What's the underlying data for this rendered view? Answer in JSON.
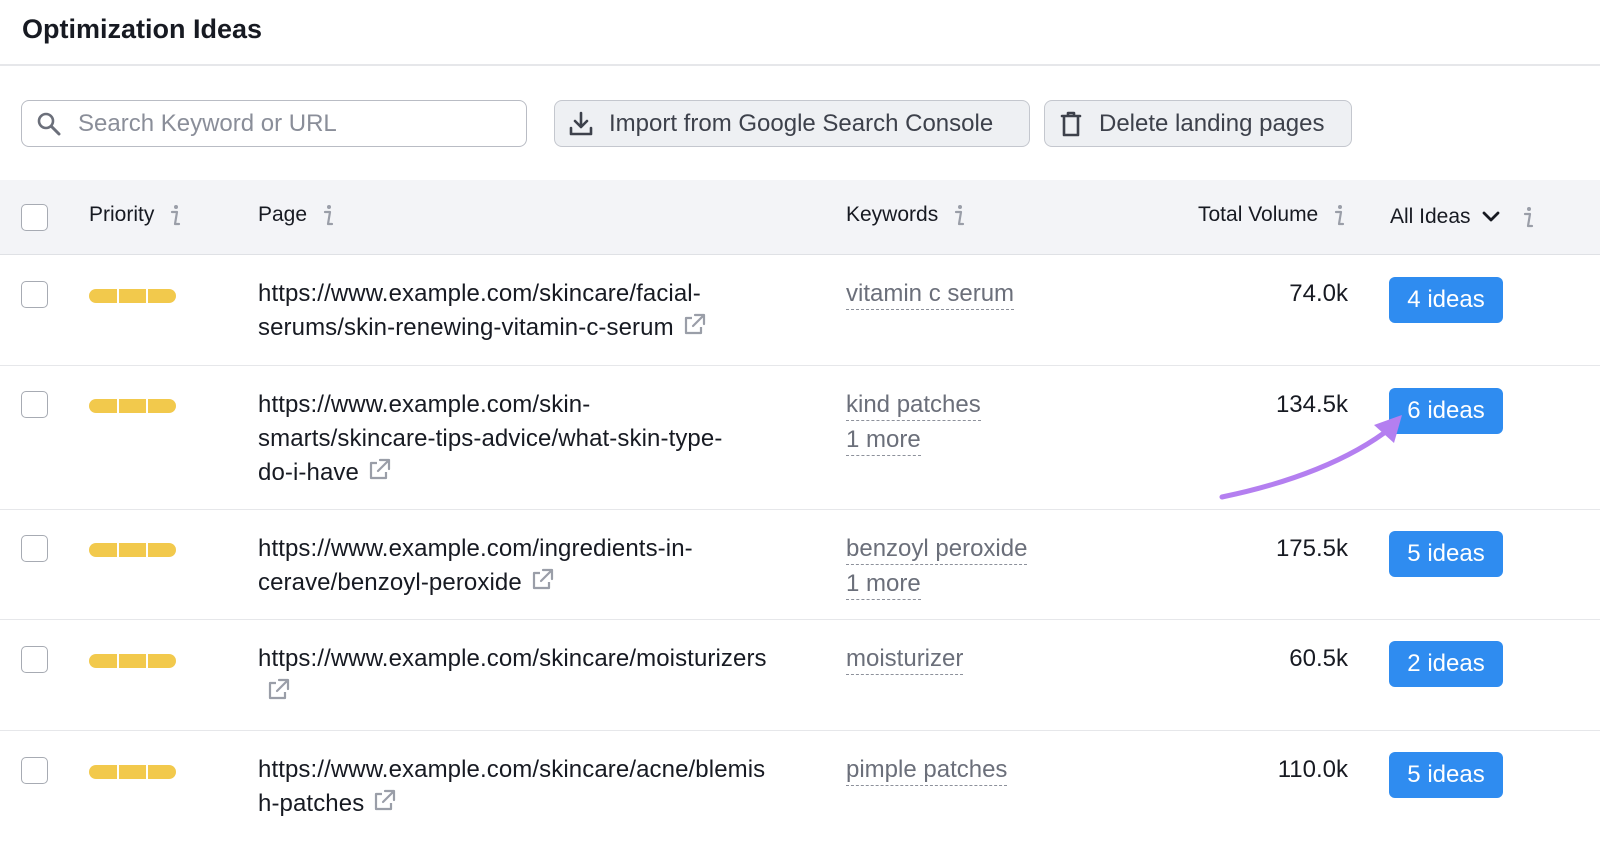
{
  "header": {
    "title": "Optimization Ideas"
  },
  "toolbar": {
    "search_placeholder": "Search Keyword or URL",
    "search_value": "",
    "import_label": "Import from Google Search Console",
    "delete_label": "Delete landing pages"
  },
  "table": {
    "columns": {
      "priority": "Priority",
      "page": "Page",
      "keywords": "Keywords",
      "volume": "Total Volume",
      "ideas_filter": "All Ideas"
    },
    "rows": [
      {
        "priority_level": 3,
        "page_lines": [
          "https://www.example.com/skincare/facial-",
          "serums/skin-renewing-vitamin-c-serum"
        ],
        "keywords": [
          "vitamin c serum"
        ],
        "volume": "74.0k",
        "ideas": "4 ideas"
      },
      {
        "priority_level": 3,
        "page_lines": [
          "https://www.example.com/skin-",
          "smarts/skincare-tips-advice/what-skin-type-",
          "do-i-have"
        ],
        "keywords": [
          "kind patches",
          "1 more"
        ],
        "volume": "134.5k",
        "ideas": "6 ideas"
      },
      {
        "priority_level": 3,
        "page_lines": [
          "https://www.example.com/ingredients-in-",
          "cerave/benzoyl-peroxide"
        ],
        "keywords": [
          "benzoyl peroxide",
          "1 more"
        ],
        "volume": "175.5k",
        "ideas": "5 ideas"
      },
      {
        "priority_level": 3,
        "page_lines": [
          "https://www.example.com/skincare/moisturizers",
          ""
        ],
        "keywords": [
          "moisturizer"
        ],
        "volume": "60.5k",
        "ideas": "2 ideas"
      },
      {
        "priority_level": 3,
        "page_lines": [
          "https://www.example.com/skincare/acne/blemis",
          "h-patches"
        ],
        "keywords": [
          "pimple patches"
        ],
        "volume": "110.0k",
        "ideas": "5 ideas"
      }
    ]
  },
  "colors": {
    "priority_bar": "#f2c94c",
    "ideas_button": "#2f8cf0",
    "annotation_arrow": "#b47ff0"
  },
  "icons": {
    "search": "search-icon",
    "import": "download-icon",
    "delete": "trash-icon",
    "info": "info-icon",
    "external_link": "external-link-icon",
    "filter": "chevron-down-icon"
  }
}
